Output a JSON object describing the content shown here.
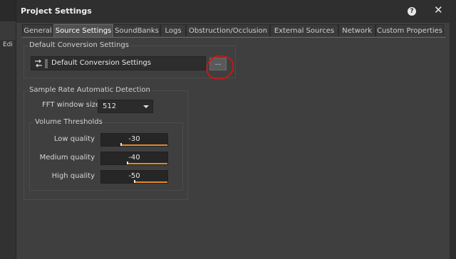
{
  "window": {
    "title": "Project Settings"
  },
  "background": {
    "edit_label": "Edi"
  },
  "tabs": [
    {
      "label": "General"
    },
    {
      "label": "Source Settings"
    },
    {
      "label": "SoundBanks"
    },
    {
      "label": "Logs"
    },
    {
      "label": "Obstruction/Occlusion"
    },
    {
      "label": "External Sources"
    },
    {
      "label": "Network"
    },
    {
      "label": "Custom Properties"
    }
  ],
  "active_tab": "Source Settings",
  "default_conversion": {
    "group_label": "Default Conversion Settings",
    "value": "Default Conversion Settings",
    "browse_label": "...",
    "icon": "conversion-settings-icon"
  },
  "sample_rate": {
    "group_label": "Sample Rate Automatic Detection",
    "fft_label": "FFT window size",
    "fft_value": "512",
    "volume_thresholds": {
      "group_label": "Volume Thresholds",
      "rows": [
        {
          "label": "Low quality",
          "value": "-30",
          "level": 0.7
        },
        {
          "label": "Medium quality",
          "value": "-40",
          "level": 0.6
        },
        {
          "label": "High quality",
          "value": "-50",
          "level": 0.5
        }
      ]
    }
  },
  "icons": {
    "help": "help-icon",
    "close": "close-icon"
  },
  "colors": {
    "accent": "#e08a2e",
    "annotation": "#e01010"
  }
}
